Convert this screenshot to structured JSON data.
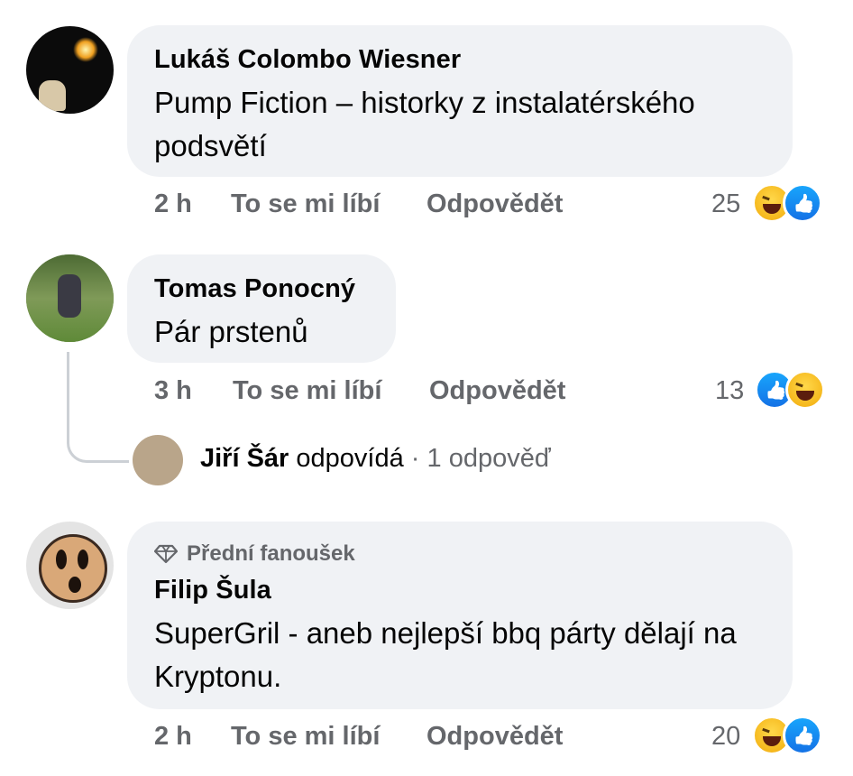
{
  "comments": [
    {
      "author": "Lukáš Colombo Wiesner",
      "text": "Pump Fiction – historky z instalatérského podsvětí",
      "time": "2 h",
      "like_label": "To se mi líbí",
      "reply_label": "Odpovědět",
      "reaction_count": "25",
      "reactions": [
        "haha-icon",
        "like-icon"
      ]
    },
    {
      "author": "Tomas Ponocný",
      "text": "Pár prstenů",
      "time": "3 h",
      "like_label": "To se mi líbí",
      "reply_label": "Odpovědět",
      "reaction_count": "13",
      "reactions": [
        "like-icon",
        "haha-icon"
      ],
      "reply_preview": {
        "author": "Jiří Šár",
        "action": "odpovídá",
        "separator": "·",
        "replies": "1 odpověď"
      }
    },
    {
      "badge": "Přední fanoušek",
      "badge_icon": "diamond-icon",
      "author": "Filip Šula",
      "text": "SuperGril - aneb nejlepší bbq párty dělají na Kryptonu.",
      "time": "2 h",
      "like_label": "To se mi líbí",
      "reply_label": "Odpovědět",
      "reaction_count": "20",
      "reactions": [
        "haha-icon",
        "like-icon"
      ]
    }
  ],
  "colors": {
    "bubble": "#f0f2f5",
    "meta_text": "#65676b",
    "like_blue": "#1877f2",
    "haha_yellow": "#f7c23a"
  }
}
